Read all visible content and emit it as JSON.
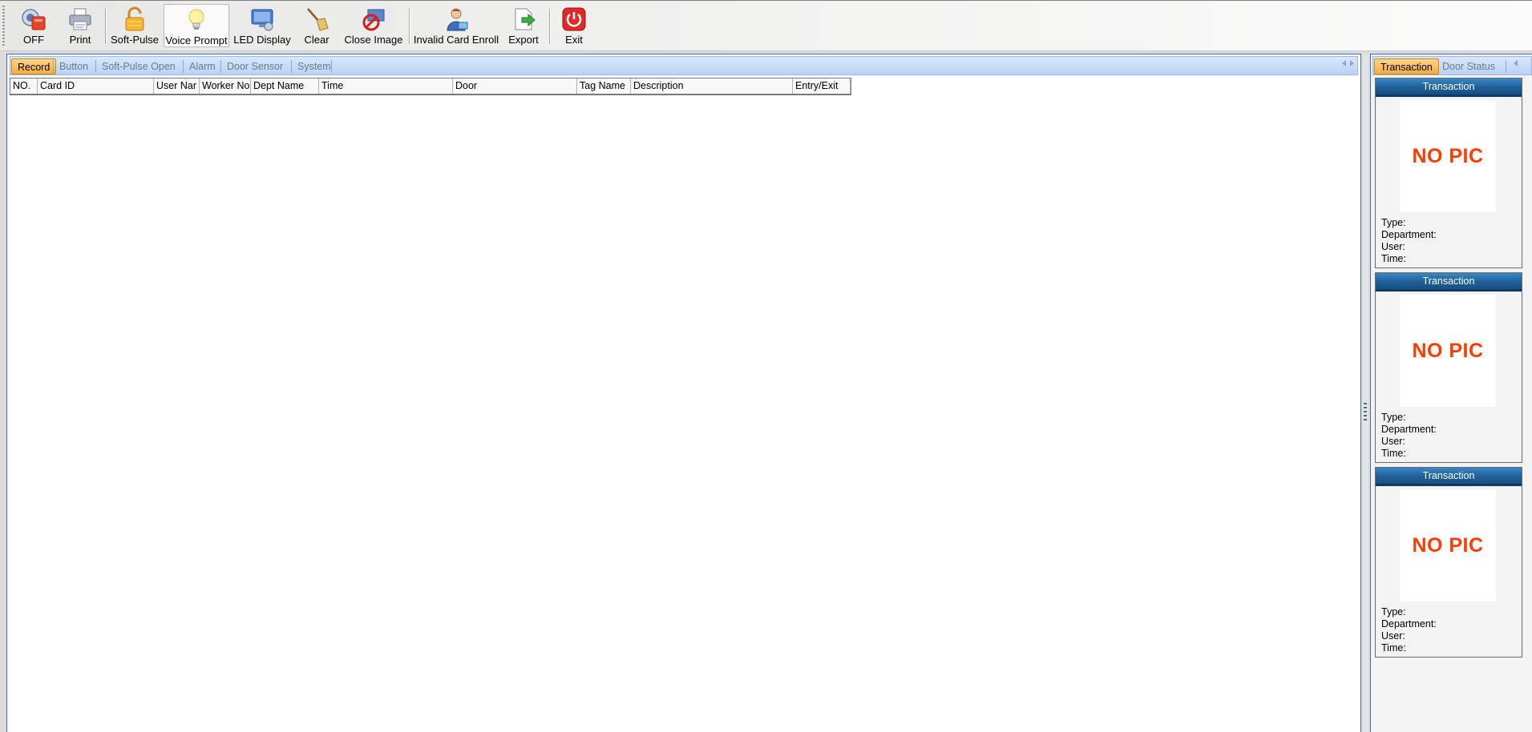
{
  "toolbar": {
    "buttons": [
      {
        "label": "OFF",
        "icon": "alarm-off-icon"
      },
      {
        "label": "Print",
        "icon": "printer-icon"
      },
      {
        "label": "Soft-Pulse",
        "icon": "unlock-icon"
      },
      {
        "label": "Voice Prompt",
        "icon": "lightbulb-icon"
      },
      {
        "label": "LED Display",
        "icon": "monitor-icon"
      },
      {
        "label": "Clear",
        "icon": "broom-icon"
      },
      {
        "label": "Close Image",
        "icon": "no-image-icon"
      },
      {
        "label": "Invalid Card Enroll",
        "icon": "user-card-icon"
      },
      {
        "label": "Export",
        "icon": "export-icon"
      },
      {
        "label": "Exit",
        "icon": "power-icon"
      }
    ],
    "pressed_button": "Voice Prompt"
  },
  "left_tabs": {
    "items": [
      "Record",
      "Button",
      "Soft-Pulse Open",
      "Alarm",
      "Door Sensor",
      "System"
    ],
    "active": "Record"
  },
  "record_table": {
    "columns": [
      "NO.",
      "Card ID",
      "User Nar",
      "Worker No.",
      "Dept Name",
      "Time",
      "Door",
      "Tag Name",
      "Description",
      "Entry/Exit"
    ],
    "rows": []
  },
  "right_tabs": {
    "items": [
      "Transaction",
      "Door Status"
    ],
    "active": "Transaction"
  },
  "transactions": [
    {
      "title": "Transaction",
      "picture_text": "NO PIC",
      "type_label": "Type:",
      "department_label": "Department:",
      "user_label": "User:",
      "time_label": "Time:"
    },
    {
      "title": "Transaction",
      "picture_text": "NO PIC",
      "type_label": "Type:",
      "department_label": "Department:",
      "user_label": "User:",
      "time_label": "Time:"
    },
    {
      "title": "Transaction",
      "picture_text": "NO PIC",
      "type_label": "Type:",
      "department_label": "Department:",
      "user_label": "User:",
      "time_label": "Time:"
    }
  ],
  "colors": {
    "accent_tab": "#f8ac3c",
    "panel_border": "#3c6fb3",
    "card_header": "#1e5f98",
    "no_pic": "#ff3c00"
  }
}
